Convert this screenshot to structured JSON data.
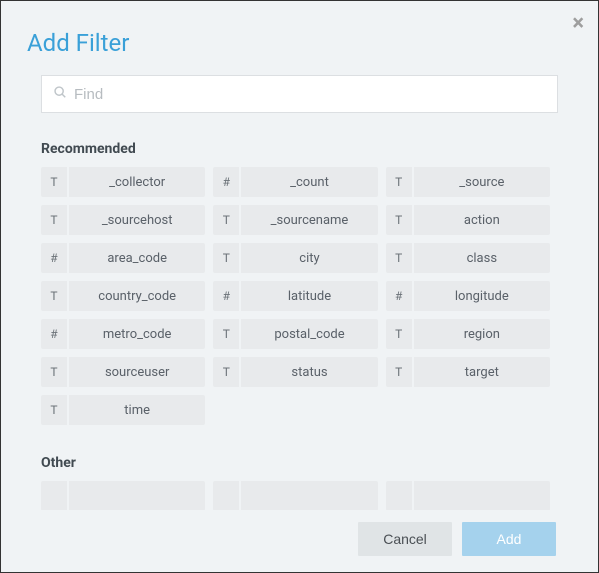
{
  "title": "Add Filter",
  "search": {
    "placeholder": "Find",
    "value": ""
  },
  "sections": {
    "recommended": {
      "title": "Recommended",
      "items": [
        {
          "type": "T",
          "label": "_collector"
        },
        {
          "type": "#",
          "label": "_count"
        },
        {
          "type": "T",
          "label": "_source"
        },
        {
          "type": "T",
          "label": "_sourcehost"
        },
        {
          "type": "T",
          "label": "_sourcename"
        },
        {
          "type": "T",
          "label": "action"
        },
        {
          "type": "#",
          "label": "area_code"
        },
        {
          "type": "T",
          "label": "city"
        },
        {
          "type": "T",
          "label": "class"
        },
        {
          "type": "T",
          "label": "country_code"
        },
        {
          "type": "#",
          "label": "latitude"
        },
        {
          "type": "#",
          "label": "longitude"
        },
        {
          "type": "#",
          "label": "metro_code"
        },
        {
          "type": "T",
          "label": "postal_code"
        },
        {
          "type": "T",
          "label": "region"
        },
        {
          "type": "T",
          "label": "sourceuser"
        },
        {
          "type": "T",
          "label": "status"
        },
        {
          "type": "T",
          "label": "target"
        },
        {
          "type": "T",
          "label": "time"
        }
      ]
    },
    "other": {
      "title": "Other",
      "items": [
        {
          "type": "",
          "label": ""
        },
        {
          "type": "",
          "label": ""
        },
        {
          "type": "",
          "label": ""
        }
      ]
    }
  },
  "buttons": {
    "cancel": "Cancel",
    "add": "Add"
  }
}
